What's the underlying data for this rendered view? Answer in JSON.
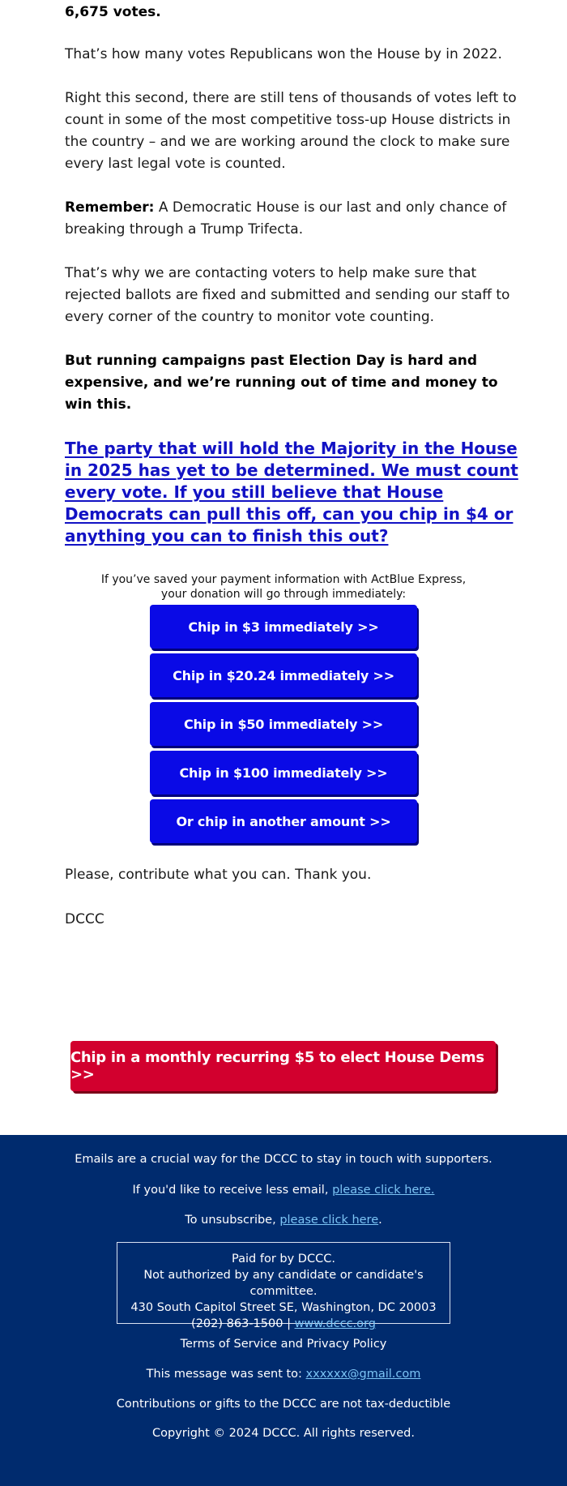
{
  "body": {
    "headline": "6,675 votes.",
    "paragraphs": {
      "p1": "That’s how many votes Republicans won the House by in 2022.",
      "p2": "Right this second, there are still tens of thousands of votes left to count in some of the most competitive toss-up House districts in the country – and we are working around the clock to make sure every last legal vote is counted.",
      "p3_bold": "Remember:",
      "p3_rest": " A Democratic House is our last and only chance of breaking through a Trump Trifecta.",
      "p4": "That’s why we are contacting voters to help make sure that rejected ballots are fixed and submitted and sending our staff to every corner of the country to monitor vote counting.",
      "p5": "But running campaigns past Election Day is hard and expensive, and we’re running out of time and money to win this."
    },
    "ask_link": "The party that will hold the Majority in the House in 2025 has yet to be determined. We must count every vote. If you still believe that House Democrats can pull this off, can you chip in $4 or anything you can to finish this out?",
    "express_note_line1": "If you’ve saved your payment information with ActBlue Express,",
    "express_note_line2": "your donation will go through immediately:",
    "donate_buttons": [
      {
        "label": "Chip in $3 immediately >>"
      },
      {
        "label": "Chip in $20.24 immediately >>"
      },
      {
        "label": "Chip in $50 immediately >>"
      },
      {
        "label": "Chip in $100 immediately >>"
      },
      {
        "label": "Or chip in another amount >>"
      }
    ],
    "closing": "Please, contribute what you can. Thank you.",
    "signature": "DCCC",
    "recurring_button": "Chip in a monthly recurring $5 to elect House Dems >>"
  },
  "footer": {
    "intro": "Emails are a crucial way for the DCCC to stay in touch with supporters.",
    "less_email_prefix": "If you'd like to receive less email, ",
    "less_email_link": "please click here.",
    "unsubscribe_prefix": "To unsubscribe, ",
    "unsubscribe_link": "please click here",
    "unsubscribe_suffix": ".",
    "disclaimer": {
      "line1": "Paid for by DCCC.",
      "line2": "Not authorized by any candidate or candidate's committee.",
      "line3": "430 South Capitol Street SE, Washington, DC 20003",
      "phone": "(202) 863-1500 | ",
      "website": "www.dccc.org"
    },
    "terms": "Terms of Service and Privacy Policy",
    "sent_to_prefix": "This message was sent to: ",
    "sent_to_email": "xxxxxx@gmail.com",
    "tax_note": "Contributions or gifts to the DCCC are not tax-deductible",
    "copyright": "Copyright © 2024 DCCC. All rights reserved."
  },
  "colors": {
    "link_blue": "#1212c4",
    "button_blue": "#0a0ae6",
    "button_red": "#d2002e",
    "footer_navy": "#002b6e",
    "footer_link": "#7cc4f5"
  }
}
